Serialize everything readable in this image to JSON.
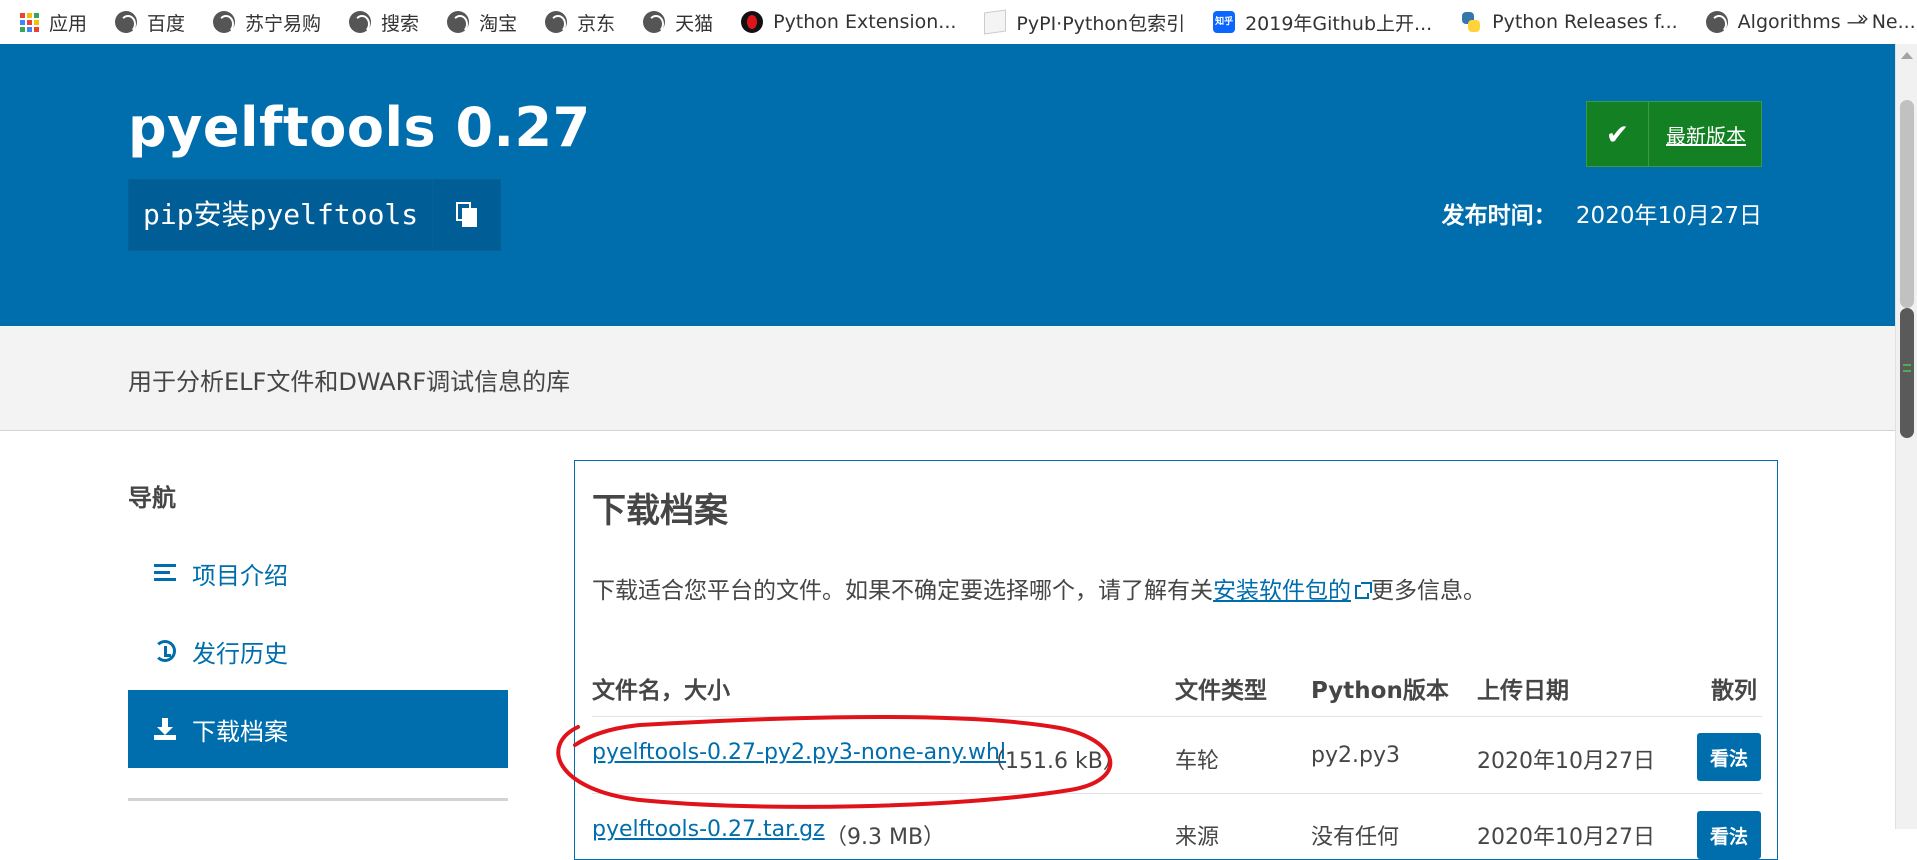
{
  "bookmarks": {
    "items": [
      {
        "label": "应用",
        "icon": "apps-icon"
      },
      {
        "label": "百度",
        "icon": "globe-icon"
      },
      {
        "label": "苏宁易购",
        "icon": "globe-icon"
      },
      {
        "label": "搜索",
        "icon": "globe-icon"
      },
      {
        "label": "淘宝",
        "icon": "globe-icon"
      },
      {
        "label": "京东",
        "icon": "globe-icon"
      },
      {
        "label": "天猫",
        "icon": "globe-icon"
      },
      {
        "label": "Python Extension...",
        "icon": "python-extension-icon"
      },
      {
        "label": "PyPI·Python包索引",
        "icon": "pypi-icon"
      },
      {
        "label": "2019年Github上开...",
        "icon": "zhihu-icon"
      },
      {
        "label": "Python Releases f...",
        "icon": "python-icon"
      },
      {
        "label": "Algorithms — Ne...",
        "icon": "globe-icon"
      }
    ],
    "more": "»"
  },
  "header": {
    "title": "pyelftools 0.27",
    "pip_command": "pip安装pyelftools",
    "latest_label": "最新版本",
    "release_label": "发布时间：",
    "release_date": "2020年10月27日"
  },
  "description": "用于分析ELF文件和DWARF调试信息的库",
  "nav": {
    "title": "导航",
    "items": [
      {
        "label": "项目介绍",
        "icon": "list-icon",
        "active": false
      },
      {
        "label": "发行历史",
        "icon": "history-icon",
        "active": false
      },
      {
        "label": "下载档案",
        "icon": "download-icon",
        "active": true
      }
    ]
  },
  "files": {
    "title": "下载档案",
    "intro_before": "下载适合您平台的文件。如果不确定要选择哪个，请了解有关",
    "intro_link": "安装软件包的",
    "intro_after": "更多信息。",
    "columns": {
      "name": "文件名，大小",
      "type": "文件类型",
      "python": "Python版本",
      "date": "上传日期",
      "hash": "散列"
    },
    "rows": [
      {
        "filename": "pyelftools-0.27-py2.py3-none-any.whl",
        "size": "（151.6 kB）",
        "type": "车轮",
        "python": "py2.py3",
        "date": "2020年10月27日",
        "action": "看法"
      },
      {
        "filename": "pyelftools-0.27.tar.gz",
        "size": "（9.3 MB）",
        "type": "来源",
        "python": "没有任何",
        "date": "2020年10月27日",
        "action": "看法"
      }
    ]
  },
  "colors": {
    "brand_blue": "#006dad",
    "latest_green": "#148024",
    "annotation_red": "#e0131b"
  }
}
